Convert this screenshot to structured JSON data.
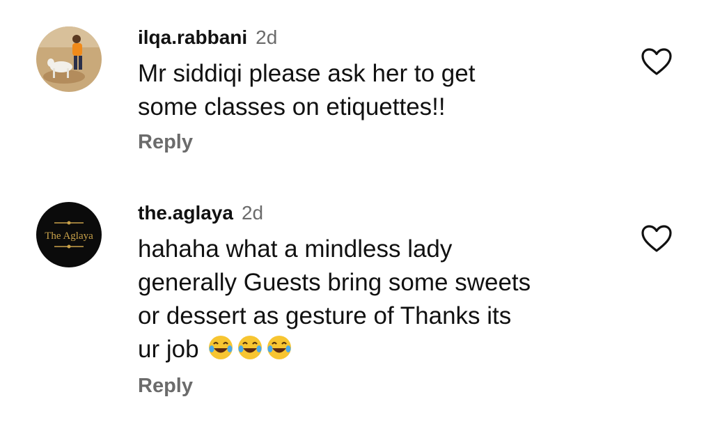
{
  "comments": [
    {
      "username": "ilqa.rabbani",
      "time": "2d",
      "lines": [
        "Mr siddiqi please ask her to get",
        "some classes on etiquettes!!"
      ],
      "reply_label": "Reply",
      "avatar_icon": "person-with-goat-photo",
      "like_icon": "heart-outline-icon"
    },
    {
      "username": "the.aglaya",
      "time": "2d",
      "lines": [
        "hahaha what a mindless lady",
        "generally Guests bring some sweets",
        "or dessert as gesture of Thanks its",
        "ur job"
      ],
      "emojis": [
        "😂",
        "😂",
        "😂"
      ],
      "reply_label": "Reply",
      "avatar_logo_text": "THE AGLAYA",
      "like_icon": "heart-outline-icon"
    }
  ],
  "colors": {
    "text": "#111111",
    "muted": "#6b6b6b",
    "logo_gold": "#c9a24a"
  }
}
